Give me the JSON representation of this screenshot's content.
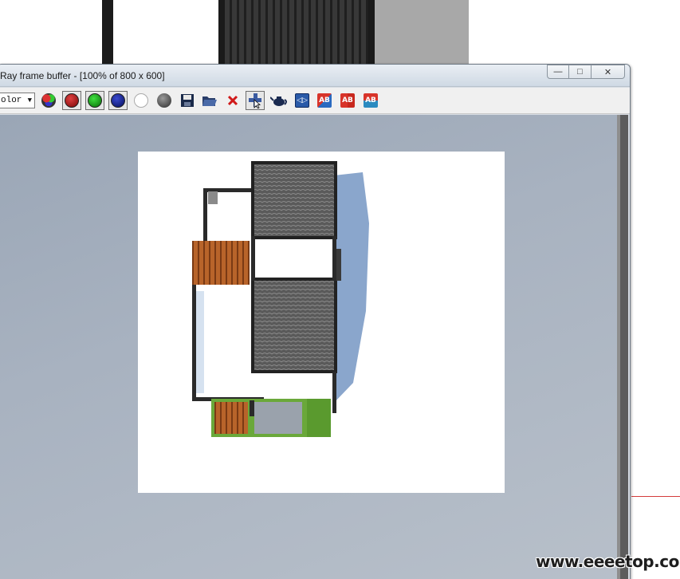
{
  "window": {
    "title": "Ray frame buffer - [100% of 800 x 600]",
    "buttons": {
      "minimize": "—",
      "maximize": "□",
      "close": "✕"
    }
  },
  "toolbar": {
    "channel_select_value": "olor",
    "buttons": [
      {
        "name": "rgb-channels-icon",
        "color": "#4a6aa0"
      },
      {
        "name": "red-channel-icon",
        "color": "#b01616"
      },
      {
        "name": "green-channel-icon",
        "color": "#0ca80c"
      },
      {
        "name": "blue-channel-icon",
        "color": "#0a1e8c"
      },
      {
        "name": "alpha-channel-icon",
        "color": "#ffffff"
      },
      {
        "name": "mono-mode-icon",
        "color": "#6a6a6a"
      },
      {
        "name": "save-image-icon"
      },
      {
        "name": "open-image-icon"
      },
      {
        "name": "clear-image-icon"
      },
      {
        "name": "track-mouse-icon"
      },
      {
        "name": "render-teapot-icon"
      },
      {
        "name": "display-correction-icon"
      },
      {
        "name": "ab-compare-horizontal-icon",
        "label": "AB"
      },
      {
        "name": "ab-compare-a-icon",
        "label": "AB"
      },
      {
        "name": "ab-compare-vertical-icon",
        "label": "AB"
      }
    ]
  },
  "watermark": "www.eeeetop.com",
  "colors": {
    "roof": "#4c4c4c",
    "wall": "#2a2a2a",
    "wood": "#b8642a",
    "grass": "#6aa83a",
    "shadow": "#7d9cc6"
  }
}
